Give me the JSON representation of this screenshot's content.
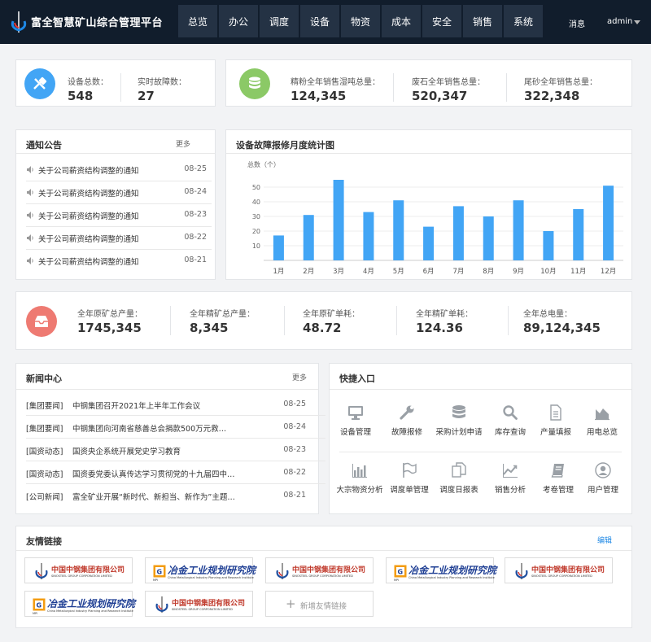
{
  "header": {
    "title": "富全智慧矿山综合管理平台",
    "nav": [
      "总览",
      "办公",
      "调度",
      "设备",
      "物资",
      "成本",
      "安全",
      "销售",
      "系统"
    ],
    "message": "消息",
    "user": "admin"
  },
  "device_stats": {
    "total_label": "设备总数：",
    "total_value": "548",
    "fault_label": "实时故障数：",
    "fault_value": "27"
  },
  "sales_stats": {
    "items": [
      {
        "label": "精粉全年销售湿吨总量：",
        "value": "124,345"
      },
      {
        "label": "废石全年销售总量：",
        "value": "520,347"
      },
      {
        "label": "尾砂全年销售总量：",
        "value": "322,348"
      }
    ]
  },
  "notice": {
    "title": "通知公告",
    "more": "更多",
    "items": [
      {
        "text": "关于公司薪资结构调整的通知",
        "date": "08-25"
      },
      {
        "text": "关于公司薪资结构调整的通知",
        "date": "08-24"
      },
      {
        "text": "关于公司薪资结构调整的通知",
        "date": "08-23"
      },
      {
        "text": "关于公司薪资结构调整的通知",
        "date": "08-22"
      },
      {
        "text": "关于公司薪资结构调整的通知",
        "date": "08-21"
      }
    ]
  },
  "chart_card": {
    "title": "设备故障报修月度统计图"
  },
  "chart_data": {
    "type": "bar",
    "title": "设备故障报修月度统计图",
    "ylabel": "总数（个）",
    "xlabel": "",
    "categories": [
      "1月",
      "2月",
      "3月",
      "4月",
      "5月",
      "6月",
      "7月",
      "8月",
      "9月",
      "10月",
      "11月",
      "12月"
    ],
    "values": [
      17,
      31,
      55,
      33,
      41,
      23,
      37,
      30,
      41,
      20,
      35,
      51
    ],
    "yticks": [
      10,
      20,
      30,
      40,
      50
    ],
    "ylim": [
      0,
      60
    ],
    "grid": true,
    "color": "#42a5f5"
  },
  "production_stats": {
    "items": [
      {
        "label": "全年原矿总产量：",
        "value": "1745,345"
      },
      {
        "label": "全年精矿总产量：",
        "value": "8,345"
      },
      {
        "label": "全年原矿单耗：",
        "value": "48.72"
      },
      {
        "label": "全年精矿单耗：",
        "value": "124.36"
      },
      {
        "label": "全年总电量：",
        "value": "89,124,345"
      }
    ]
  },
  "news": {
    "title": "新闻中心",
    "more": "更多",
    "items": [
      {
        "category": "[集团要闻]",
        "text": "中钢集团召开2021年上半年工作会议",
        "date": "08-25"
      },
      {
        "category": "[集团要闻]",
        "text": "中钢集团向河南省慈善总会捐款500万元救…",
        "date": "08-24"
      },
      {
        "category": "[国资动态]",
        "text": "国资央企系统开展党史学习教育",
        "date": "08-23"
      },
      {
        "category": "[国资动态]",
        "text": "国资委党委认真传达学习贯彻党的十九届四中…",
        "date": "08-22"
      },
      {
        "category": "[公司新闻]",
        "text": "富全矿业开展“新时代、新担当、新作为”主题…",
        "date": "08-21"
      }
    ]
  },
  "quick": {
    "title": "快捷入口",
    "items": [
      {
        "label": "设备管理",
        "icon": "monitor-icon"
      },
      {
        "label": "故障报修",
        "icon": "wrench-icon"
      },
      {
        "label": "采购计划申请",
        "icon": "database-icon"
      },
      {
        "label": "库存查询",
        "icon": "search-icon"
      },
      {
        "label": "产量填报",
        "icon": "document-icon"
      },
      {
        "label": "用电总览",
        "icon": "area-chart-icon"
      },
      {
        "label": "大宗物资分析",
        "icon": "bar-chart-icon"
      },
      {
        "label": "调度单管理",
        "icon": "flag-icon"
      },
      {
        "label": "调度日报表",
        "icon": "copy-icon"
      },
      {
        "label": "销售分析",
        "icon": "line-chart-icon"
      },
      {
        "label": "考卷管理",
        "icon": "book-icon"
      },
      {
        "label": "用户管理",
        "icon": "user-icon"
      }
    ]
  },
  "links": {
    "title": "友情链接",
    "edit": "编辑",
    "sinosteel_cn": "中国中钢集团有限公司",
    "sinosteel_en": "SINOSTEEL GROUP CORPORATION LIMITED",
    "mcc_cn": "冶金工业规划研究院",
    "mcc_en": "China Metallurgical Industry Planning and Research Institute",
    "mcc_abbr": "MPI",
    "add": "新增友情链接"
  },
  "colors": {
    "topbar": "#111d2c",
    "nav_item": "#243244",
    "device_circle": "#42a5f5",
    "sales_circle": "#8bc966",
    "production_circle": "#ee7a72",
    "bar": "#42a5f5",
    "link_accent": "#1e88e5"
  }
}
